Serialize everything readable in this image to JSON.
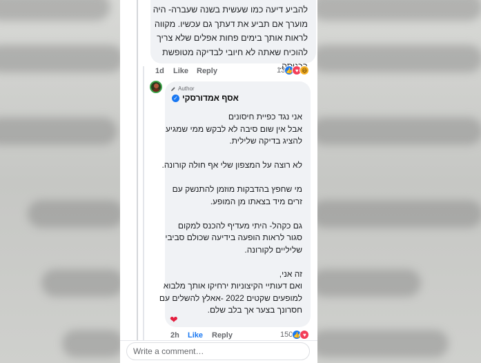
{
  "first_comment": {
    "lines": [
      "להביע דיעה כמו שעשית בשנה שעברה- היה",
      "מוערך אם תביע את דעתך גם עכשיו. מקווה",
      "לראות אותך בימים פחות אפלים שלא צריך",
      "להוכיח שאתה לא חיובי לבדיקה מטופשת",
      "בכניסה."
    ],
    "time": "1d",
    "like_label": "Like",
    "reply_label": "Reply",
    "reaction_count": "13",
    "reactions": [
      "like-icon",
      "love-icon",
      "haha-icon"
    ]
  },
  "reply_comment": {
    "author_tag": "Author",
    "author_name": "אסף אמדורסקי",
    "lines": [
      "אני נגד כפיית חיסונים",
      "אבל אין שום סיבה לא לבקש ממי שמגיע",
      "להציג בדיקה שלילית.",
      "",
      "לא רוצה על המצפון שלי אף חולה קורונה.",
      "",
      "מי שחפץ בהדבקות מוזמן להתנשק עם",
      "זרים מיד בצאתו מן המופע.",
      "",
      "גם כקהל- היתי מעדיף להכנס למקום",
      "סגור לראות הופעה בידיעה שכולם סביבי",
      "שליליים לקורונה.",
      "",
      "זה אני,",
      "ואם דעותיי הקיצוניות ירחיקו אותך מלבוא",
      "למופעים שקטים 2022 -אאלץ להשלים עם",
      "חסרונך בצער אך בלב שלם."
    ],
    "time": "2h",
    "like_label": "Like",
    "reply_label": "Reply",
    "reaction_count": "150",
    "reactions": [
      "like-icon",
      "love-icon"
    ],
    "own_reaction": "heart"
  },
  "composer": {
    "placeholder": "Write a comment…"
  },
  "colors": {
    "bubble": "#f0f2f5",
    "meta": "#65676b",
    "accent": "#1877f2",
    "love": "#f33e58"
  }
}
